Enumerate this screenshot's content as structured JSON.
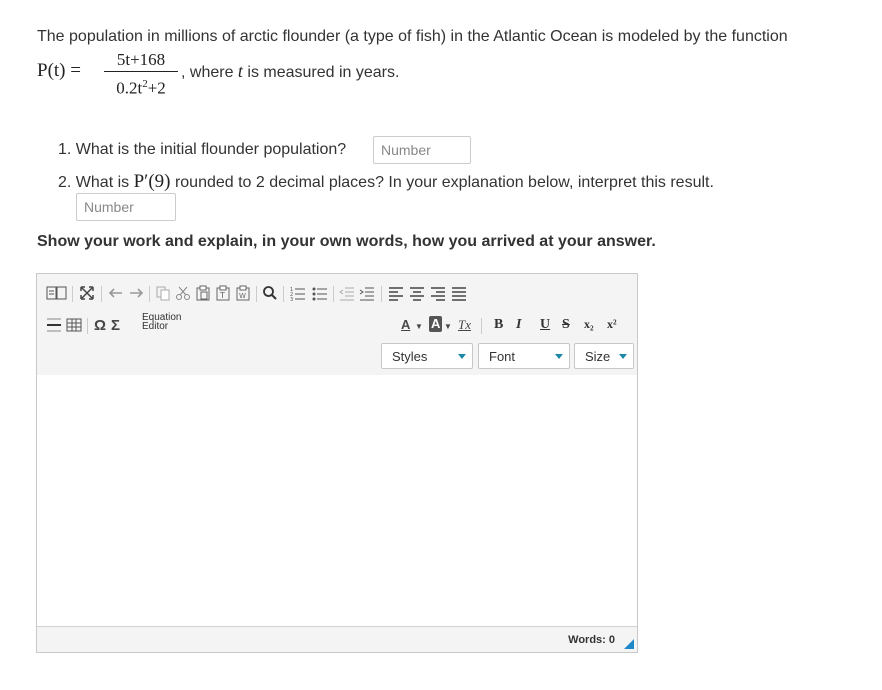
{
  "question": {
    "intro": "The population in millions of arctic flounder (a type of fish) in the Atlantic Ocean is modeled by the function",
    "lhs": "P(t) =",
    "numerator": "5t+168",
    "denominator_base": "0.2t",
    "denominator_exp": "2",
    "denominator_tail": "+2",
    "where_prefix": ", where",
    "where_var": "t",
    "where_suffix": "is measured in years."
  },
  "parts": [
    {
      "text": "1. What is the initial flounder population?",
      "placeholder": "Number",
      "value": ""
    },
    {
      "prefix": "2. What is",
      "math": "P′(9)",
      "suffix": "rounded to 2 decimal places? In your explanation below, interpret this result.",
      "placeholder": "Number",
      "value": ""
    }
  ],
  "show_work": "Show your work and explain, in your own words, how you arrived at your answer.",
  "editor": {
    "equation_line1": "Equation",
    "equation_line2": "Editor",
    "omega": "Ω",
    "sigma": "Σ",
    "font_color": "A",
    "bg_color": "A",
    "remove_format": "Tx",
    "bold": "B",
    "italic": "I",
    "underline": "U",
    "strike": "S",
    "subscript": "x₂",
    "superscript": "x²",
    "styles_label": "Styles",
    "font_label": "Font",
    "size_label": "Size",
    "word_count": "Words: 0",
    "content": ""
  },
  "colors": {
    "accent": "#1e88a8",
    "toolbar_bg": "#f4f4f4",
    "border": "#c8c8c8"
  }
}
